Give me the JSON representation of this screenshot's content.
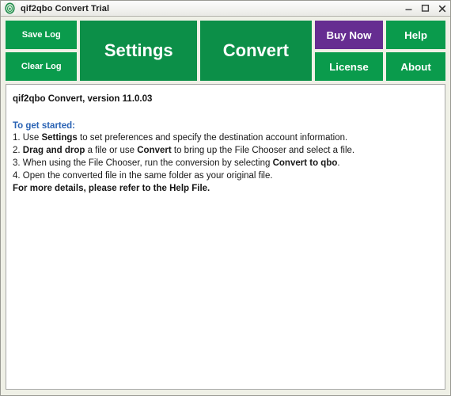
{
  "window": {
    "title": "qif2qbo Convert Trial",
    "icon": "app-thumbprint-icon",
    "controls": {
      "minimize": "minimize-icon",
      "maximize": "maximize-icon",
      "close": "close-icon"
    }
  },
  "colors": {
    "green": "#0a9b4c",
    "green_dark": "#0c8f48",
    "purple": "#662d91",
    "frame": "#eff0e6",
    "panel": "#ffffff",
    "link_blue": "#2a63b4"
  },
  "toolbar": {
    "save_log": "Save Log",
    "clear_log": "Clear Log",
    "settings": "Settings",
    "convert": "Convert",
    "buy_now": "Buy Now",
    "license": "License",
    "help": "Help",
    "about": "About"
  },
  "content": {
    "version_line": "qif2qbo Convert, version 11.0.03",
    "get_started_heading": "To get started:",
    "steps": [
      {
        "number": "1. ",
        "parts": [
          {
            "text": "Use ",
            "bold": false
          },
          {
            "text": "Settings",
            "bold": true
          },
          {
            "text": " to set preferences and specify the destination account information.",
            "bold": false
          }
        ]
      },
      {
        "number": "2. ",
        "parts": [
          {
            "text": "Drag and drop",
            "bold": true
          },
          {
            "text": " a file or use ",
            "bold": false
          },
          {
            "text": "Convert",
            "bold": true
          },
          {
            "text": " to bring up the File Chooser and select a file.",
            "bold": false
          }
        ]
      },
      {
        "number": "3. ",
        "parts": [
          {
            "text": "When using the File Chooser, run the conversion by selecting ",
            "bold": false
          },
          {
            "text": "Convert to qbo",
            "bold": true
          },
          {
            "text": ".",
            "bold": false
          }
        ]
      },
      {
        "number": "4. ",
        "parts": [
          {
            "text": "Open the converted file in the same folder as your original file.",
            "bold": false
          }
        ]
      }
    ],
    "footer_line": "For more details, please refer to the Help File."
  }
}
